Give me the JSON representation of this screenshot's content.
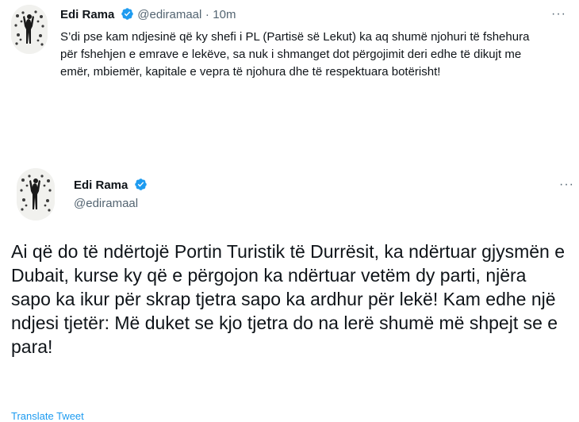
{
  "tweet1": {
    "author_name": "Edi Rama",
    "handle": "@ediramaal",
    "separator": "·",
    "time": "10m",
    "more": "···",
    "text": "S’di pse kam ndjesinë që ky shefi i PL (Partisë së Lekut) ka aq shumë njohuri të fshehura për fshehjen e emrave e lekëve, sa nuk i shmanget dot përgojimit deri edhe të dikujt me emër, mbiemër, kapitale e vepra të njohura dhe të respektuara botërisht!"
  },
  "tweet2": {
    "author_name": "Edi Rama",
    "handle": "@ediramaal",
    "more": "···",
    "text": "Ai që do të ndërtojë Portin Turistik të Durrësit, ka ndërtuar gjysmën e Dubait, kurse ky që e përgojon ka ndërtuar vetëm dy parti, njëra sapo ka ikur për skrap tjetra sapo ka ardhur për lekë! Kam edhe një ndjesi tjetër: Më duket se kjo tjetra do na lerë shumë më shpejt se e para!",
    "translate": "Translate Tweet"
  },
  "icons": {
    "verified": "verified-badge-icon",
    "more": "more-options-icon"
  },
  "colors": {
    "accent": "#1d9bf0",
    "secondary_text": "#536471",
    "primary_text": "#0f1419"
  }
}
